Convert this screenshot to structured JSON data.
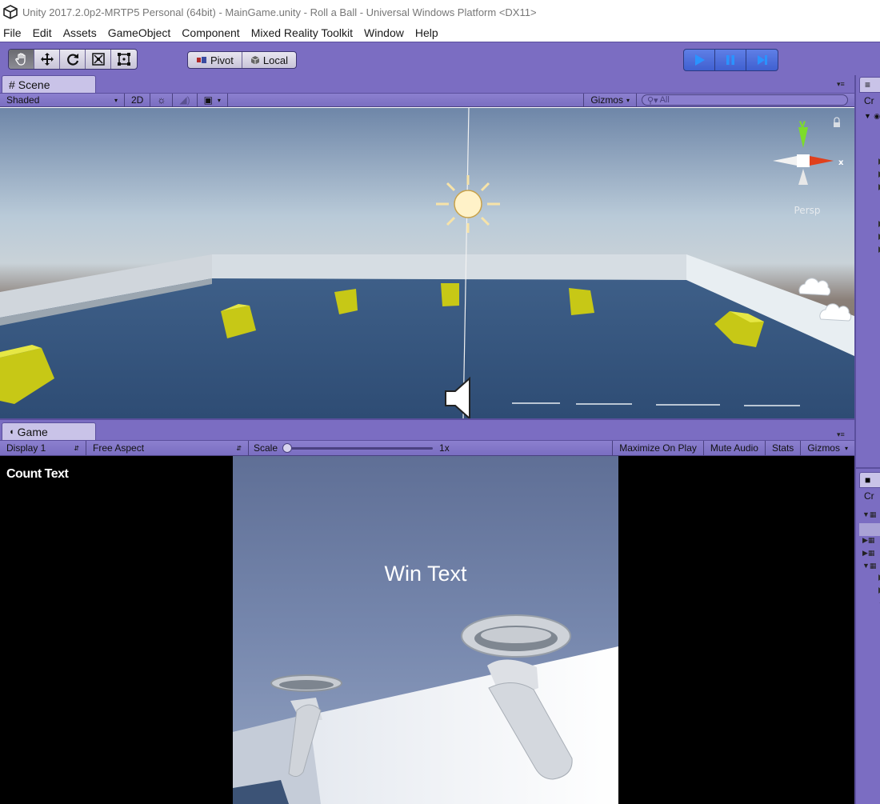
{
  "window": {
    "title": "Unity 2017.2.0p2-MRTP5 Personal (64bit) - MainGame.unity - Roll a Ball - Universal Windows Platform <DX11>"
  },
  "menu": {
    "items": [
      "File",
      "Edit",
      "Assets",
      "GameObject",
      "Component",
      "Mixed Reality Toolkit",
      "Window",
      "Help"
    ]
  },
  "toolbar": {
    "transform_tools": [
      "hand-icon",
      "move-icon",
      "rotate-icon",
      "scale-icon",
      "rect-transform-icon"
    ],
    "pivot_label": "Pivot",
    "local_label": "Local",
    "play_controls": [
      "play-icon",
      "pause-icon",
      "step-icon"
    ]
  },
  "scene": {
    "tab_label": "Scene",
    "shading_mode": "Shaded",
    "mode_2d": "2D",
    "gizmos_label": "Gizmos",
    "search_placeholder": "All",
    "gizmo_axis_label": "y",
    "gizmo_axis_x_label": "x",
    "projection_label": "Persp"
  },
  "game": {
    "tab_label": "Game",
    "display": "Display 1",
    "aspect": "Free Aspect",
    "scale_label": "Scale",
    "scale_value": "1x",
    "scale_level": 0.0,
    "maximize_on_play": "Maximize On Play",
    "mute_audio": "Mute Audio",
    "stats": "Stats",
    "gizmos": "Gizmos",
    "count_text": "Count Text",
    "win_text": "Win Text"
  },
  "right_panel": {
    "hierarchy_label": "Cr",
    "project_label": "Cr"
  },
  "colors": {
    "editor_purple": "#7b6dc2",
    "play_blue": "#2a93ff",
    "pickup_yellow": "#d4d619",
    "floor_blue": "#3a5f8a"
  }
}
